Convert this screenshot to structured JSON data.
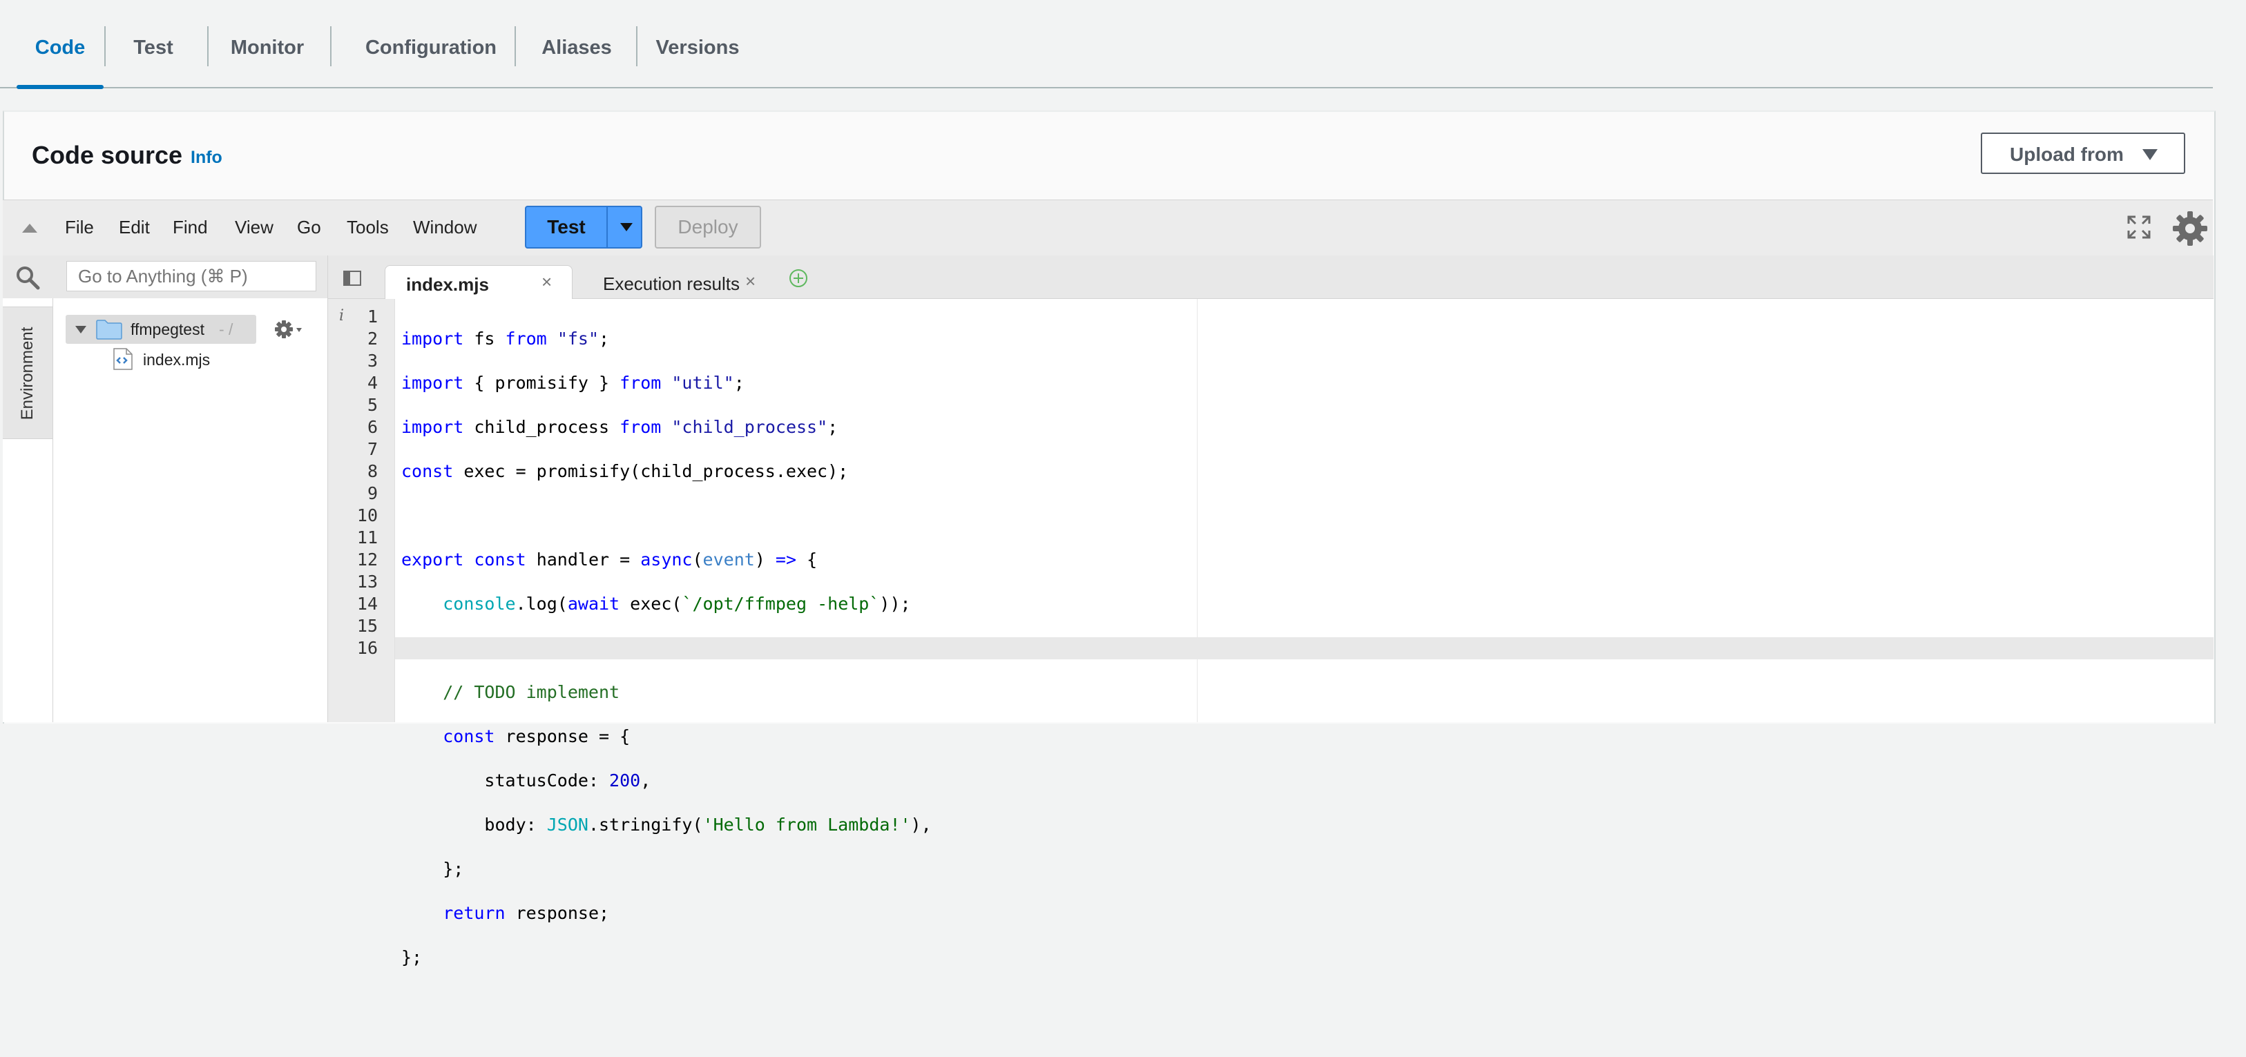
{
  "tabs": [
    "Code",
    "Test",
    "Monitor",
    "Configuration",
    "Aliases",
    "Versions"
  ],
  "panel": {
    "title": "Code source",
    "info": "Info",
    "upload_button": "Upload from"
  },
  "menu": {
    "items": [
      "File",
      "Edit",
      "Find",
      "View",
      "Go",
      "Tools",
      "Window"
    ],
    "test_button": "Test",
    "deploy_button": "Deploy"
  },
  "sidebar": {
    "search_placeholder": "Go to Anything (⌘ P)",
    "environment_label": "Environment",
    "root_folder": "ffmpegtest",
    "root_path": "- /",
    "files": [
      "index.mjs"
    ]
  },
  "editor": {
    "tabs": [
      {
        "name": "index.mjs",
        "active": true
      },
      {
        "name": "Execution results",
        "active": false
      }
    ],
    "gutter_info": "i",
    "line_count": 16,
    "current_line": 16
  },
  "colors": {
    "accent": "#0073bb",
    "test_button": "#4fa0ff",
    "keyword": "#0000ff",
    "comment": "#236e24"
  }
}
